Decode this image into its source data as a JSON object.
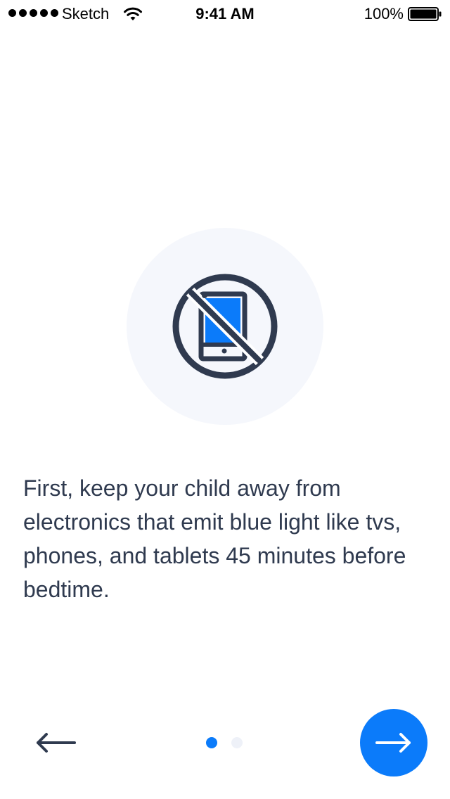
{
  "status_bar": {
    "carrier": "Sketch",
    "time": "9:41 AM",
    "battery_percent": "100%",
    "signal_dots": 5
  },
  "illustration": {
    "icon": "no-devices-icon",
    "background_color": "#f5f7fc",
    "icon_stroke_color": "#2f3a4f",
    "icon_fill_color": "#0b7bfa"
  },
  "message": {
    "text": "First, keep your child away from electronics that emit blue light like tvs, phones, and tablets 45 minutes before bedtime."
  },
  "navigation": {
    "back_icon": "arrow-left-icon",
    "next_icon": "arrow-right-icon",
    "next_button_color": "#0b7bfa",
    "pager": {
      "total": 2,
      "current": 1,
      "active_color": "#0b7bfa",
      "inactive_color": "#eef1f8"
    }
  }
}
